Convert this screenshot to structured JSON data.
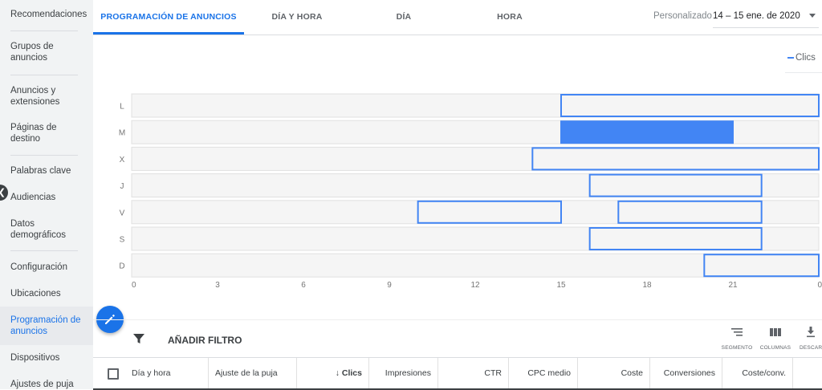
{
  "sidebar": {
    "items": [
      {
        "label": "Recomendaciones"
      },
      {
        "label": "Grupos de anuncios"
      },
      {
        "label": "Anuncios y extensiones"
      },
      {
        "label": "Páginas de destino"
      },
      {
        "label": "Palabras clave"
      },
      {
        "label": "Audiencias"
      },
      {
        "label": "Datos demográficos"
      },
      {
        "label": "Configuración"
      },
      {
        "label": "Ubicaciones"
      },
      {
        "label": "Programación de anuncios"
      },
      {
        "label": "Dispositivos"
      },
      {
        "label": "Ajustes de puja"
      }
    ],
    "active_item": "Programación de anuncios"
  },
  "tabs": [
    {
      "label": "PROGRAMACIÓN DE ANUNCIOS",
      "active": true
    },
    {
      "label": "DÍA Y HORA",
      "active": false
    },
    {
      "label": "DÍA",
      "active": false
    },
    {
      "label": "HORA",
      "active": false
    }
  ],
  "date_range": {
    "label": "Personalizado",
    "value": "14 – 15 ene. de 2020"
  },
  "metric": {
    "label": "Clics",
    "color": "#4285f4"
  },
  "chart_data": {
    "type": "schedule",
    "days": [
      "L",
      "M",
      "X",
      "J",
      "V",
      "S",
      "D"
    ],
    "x_ticks": [
      "0",
      "3",
      "6",
      "9",
      "12",
      "15",
      "18",
      "21",
      "0"
    ],
    "xlim": [
      0,
      24
    ],
    "schedule": [
      {
        "day": "L",
        "start": 15,
        "end": 24,
        "filled": false
      },
      {
        "day": "M",
        "start": 15,
        "end": 21,
        "filled": true
      },
      {
        "day": "X",
        "start": 14,
        "end": 24,
        "filled": false
      },
      {
        "day": "J",
        "start": 16,
        "end": 22,
        "filled": false
      },
      {
        "day": "V",
        "start": 10,
        "end": 15,
        "filled": false
      },
      {
        "day": "V",
        "start": 17,
        "end": 22,
        "filled": false
      },
      {
        "day": "S",
        "start": 16,
        "end": 22,
        "filled": false
      },
      {
        "day": "D",
        "start": 20,
        "end": 24,
        "filled": false
      }
    ],
    "colors": {
      "active": "#4285f4",
      "track": "#f5f5f5",
      "track_border": "#e0e0e0"
    }
  },
  "toolbar": {
    "add_filter": "AÑADIR FILTRO",
    "segment": "SEGMENTO",
    "columns": "COLUMNAS",
    "download": "DESCAR"
  },
  "table": {
    "columns": [
      "Día y hora",
      "Ajuste de la puja",
      "Clics",
      "Impresiones",
      "CTR",
      "CPC medio",
      "Coste",
      "Conversiones",
      "Coste/conv."
    ],
    "sort_indicator": "↓"
  }
}
